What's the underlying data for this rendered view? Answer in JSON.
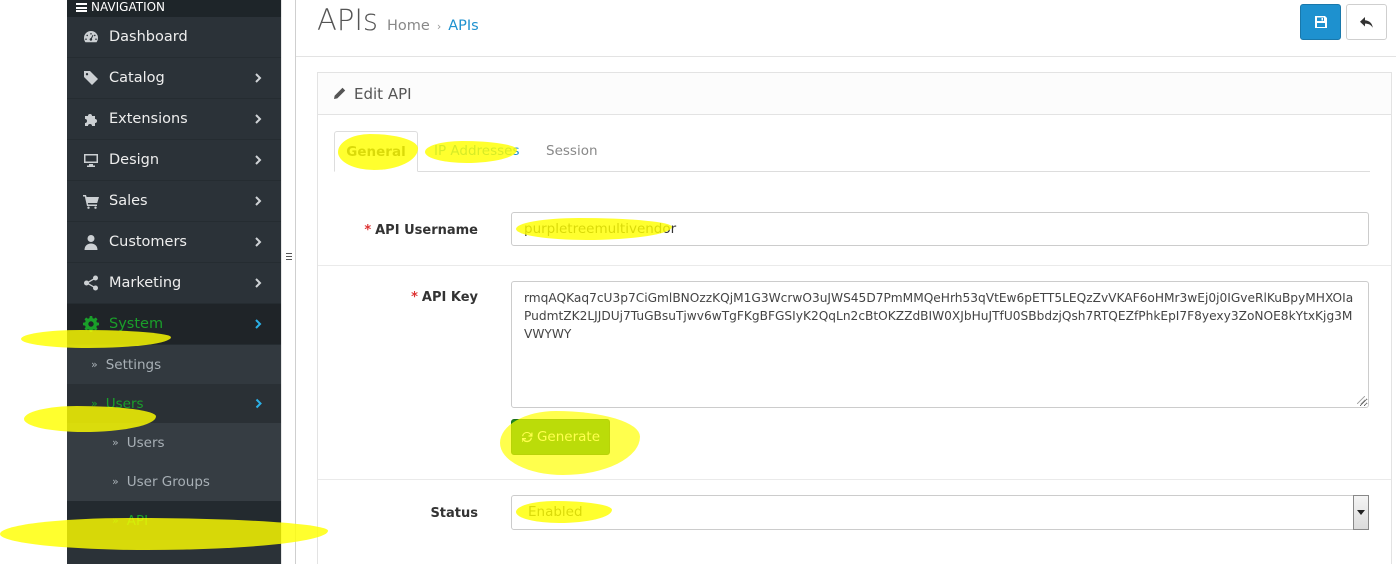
{
  "sidebar": {
    "heading": "NAVIGATION",
    "items": [
      {
        "label": "Dashboard"
      },
      {
        "label": "Catalog"
      },
      {
        "label": "Extensions"
      },
      {
        "label": "Design"
      },
      {
        "label": "Sales"
      },
      {
        "label": "Customers"
      },
      {
        "label": "Marketing"
      },
      {
        "label": "System"
      }
    ],
    "system_sub": {
      "settings": "Settings",
      "users": "Users",
      "users_sub": [
        "Users",
        "User Groups",
        "API"
      ]
    },
    "raquo": "»"
  },
  "header": {
    "title": "APIs",
    "breadcrumb_home": "Home",
    "breadcrumb_sep": "›",
    "breadcrumb_current": "APIs"
  },
  "panel": {
    "title": "Edit API",
    "tabs": [
      "General",
      "IP Addresses",
      "Session"
    ]
  },
  "form": {
    "username_label": "API Username",
    "username_value": "purpletreemultivendor",
    "key_label": "API Key",
    "key_value": "rmqAQKaq7cU3p7CiGmlBNOzzKQjM1G3WcrwO3uJWS45D7PmMMQeHrh53qVtEw6pETT5LEQzZvVKAF6oHMr3wEj0j0IGveRlKuBpyMHXOIaPudmtZK2LJJDUj7TuGBsuTjwv6wTgFKgBFGSIyK2QqLn2cBtOKZZdBIW0XJbHuJTfU0SBbdzjQsh7RTQEZfPhkEpI7F8yexy3ZoNOE8kYtxKjg3MVWYWY",
    "generate_label": "Generate",
    "status_label": "Status",
    "status_value": "Enabled",
    "required_mark": "*"
  },
  "colors": {
    "sidebar_bg": "#2b3238",
    "active_green": "#1a9f2a",
    "primary_blue": "#1e91cf",
    "generate_green": "#1f8a1f",
    "highlight_yellow": "#ffff00"
  },
  "icons": {
    "dashboard": "dashboard-icon",
    "catalog": "tag-icon",
    "extensions": "puzzle-icon",
    "design": "monitor-icon",
    "sales": "cart-icon",
    "customers": "user-icon",
    "marketing": "share-icon",
    "system": "gear-icon",
    "save": "save-icon",
    "back": "reply-icon",
    "edit": "pencil-icon",
    "generate": "refresh-icon"
  }
}
